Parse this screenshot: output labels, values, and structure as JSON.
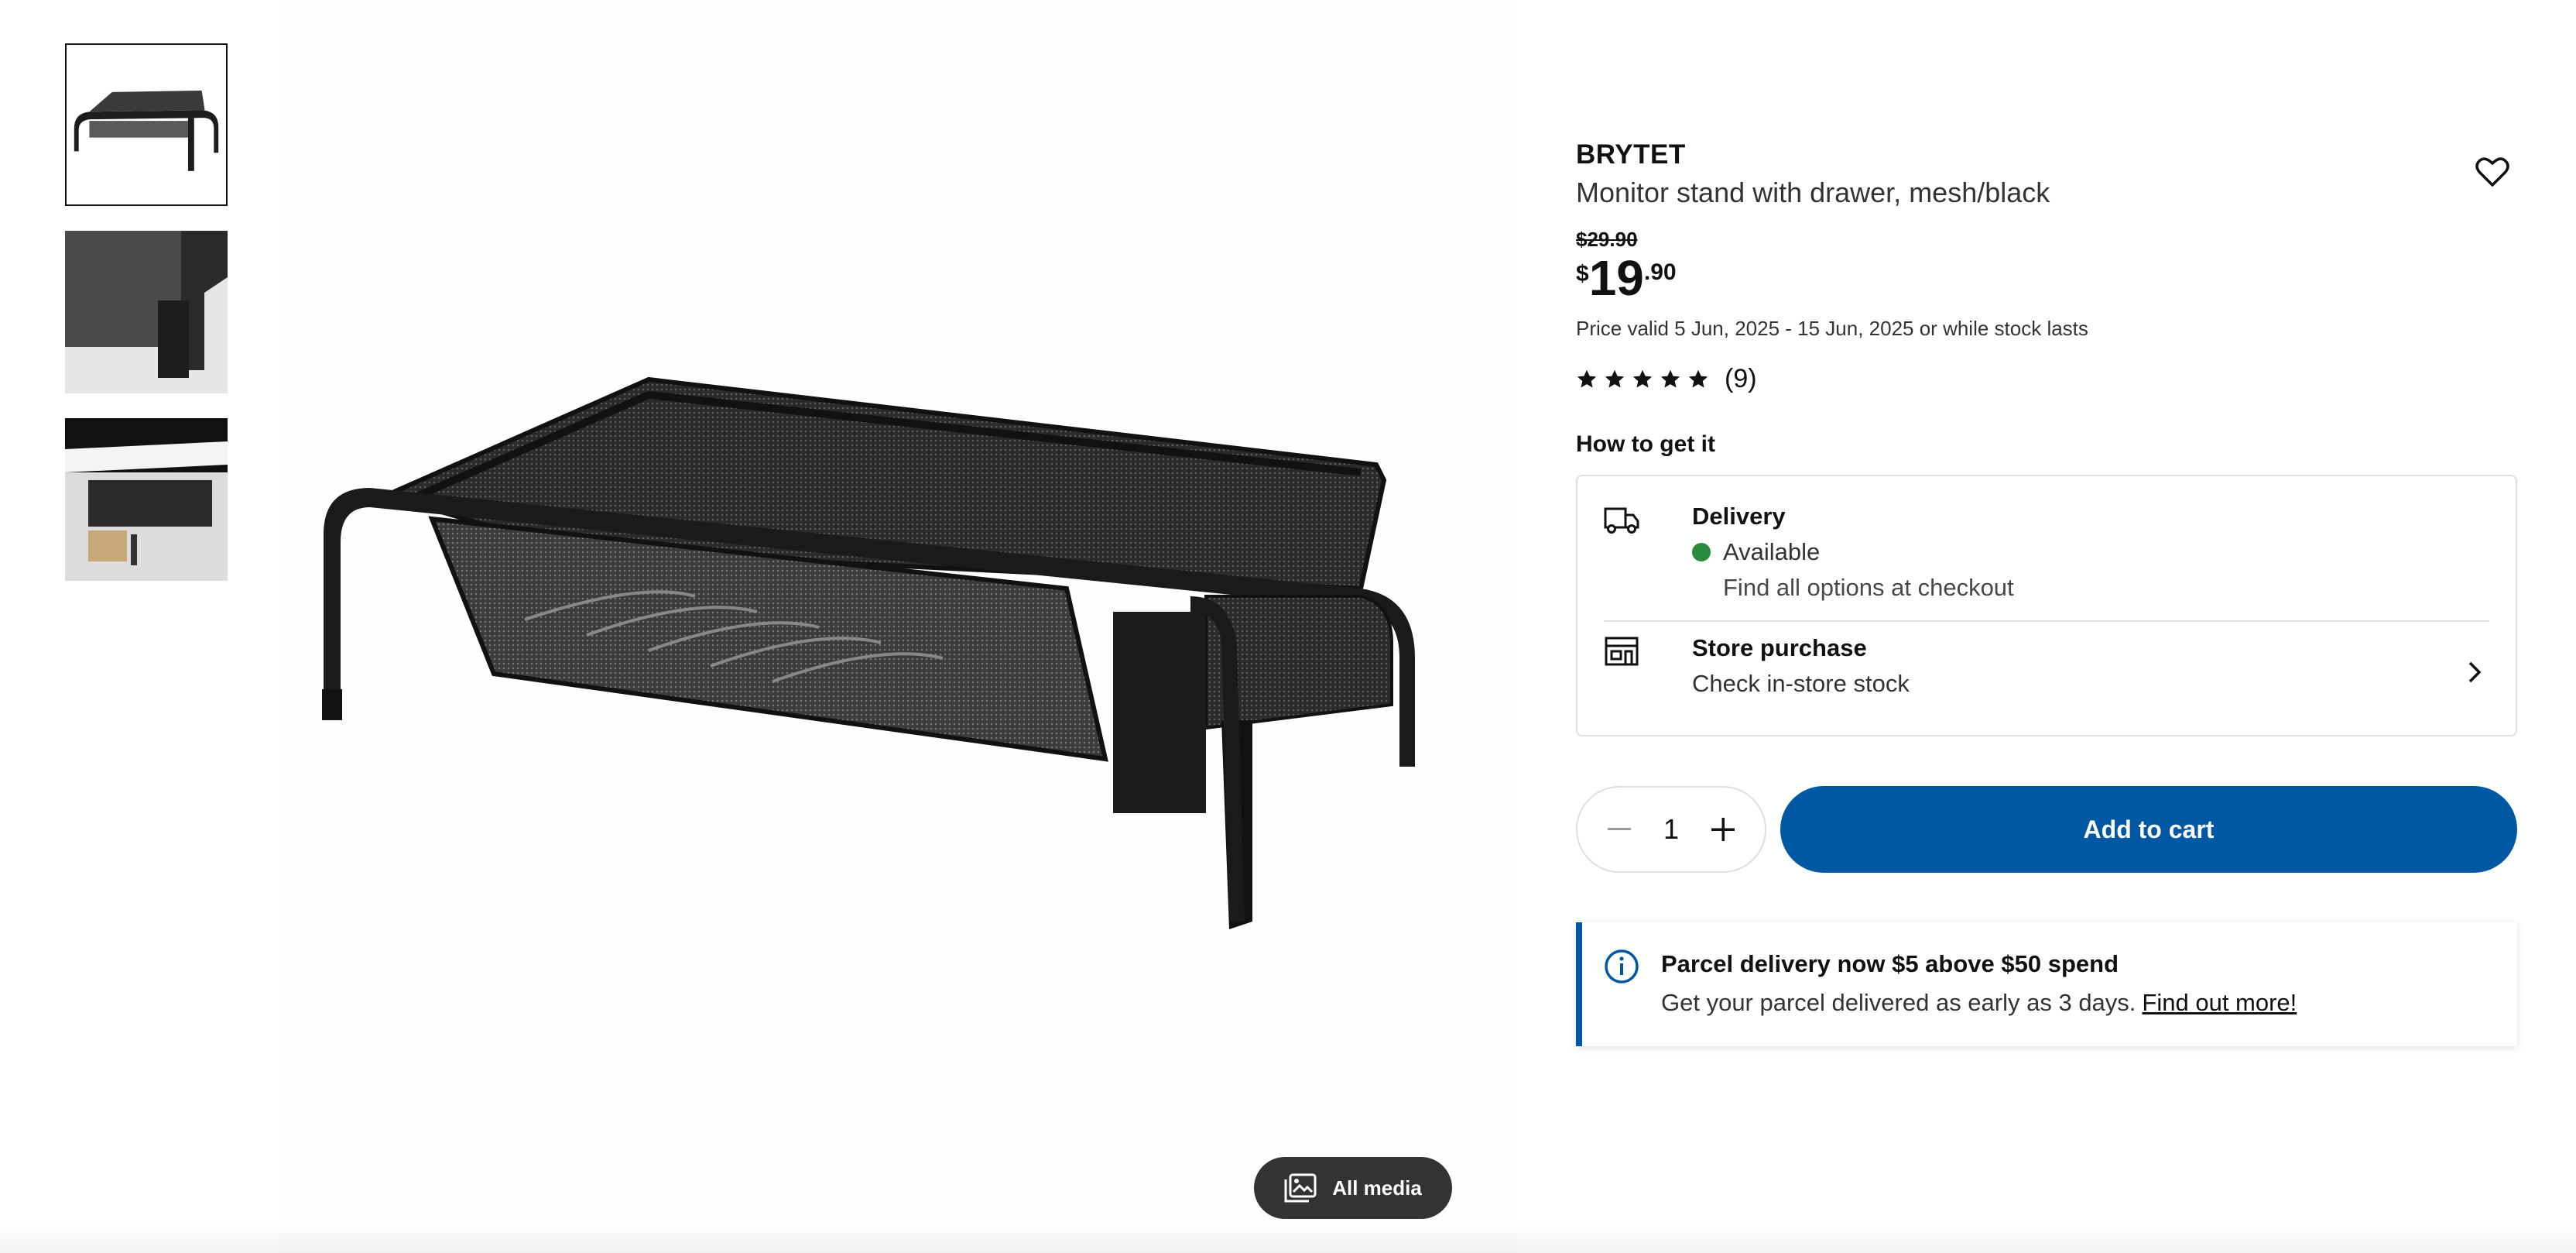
{
  "product": {
    "brand": "BRYTET",
    "description": "Monitor stand with drawer, mesh/black",
    "old_price": "$29.90",
    "price_currency": "$",
    "price_integer": "19",
    "price_decimal": ".90",
    "validity": "Price valid 5 Jun, 2025 - 15 Jun, 2025 or while stock lasts",
    "rating_stars": 5,
    "rating_count": "(9)"
  },
  "media": {
    "thumbnails": [
      "thumbnail-1",
      "thumbnail-2",
      "thumbnail-3"
    ],
    "active_thumbnail": 0,
    "all_media_label": "All media"
  },
  "fulfillment": {
    "title": "How to get it",
    "delivery": {
      "title": "Delivery",
      "status": "Available",
      "note": "Find all options at checkout"
    },
    "store": {
      "title": "Store purchase",
      "note": "Check in-store stock"
    }
  },
  "purchase": {
    "quantity": "1",
    "add_to_cart_label": "Add to cart"
  },
  "notice": {
    "title": "Parcel delivery now $5 above $50 spend",
    "body": "Get your parcel delivered as early as 3 days.",
    "link": "Find out more!"
  },
  "colors": {
    "primary_blue": "#0058a3",
    "available_green": "#2a8a3e",
    "dark_button": "#333333"
  }
}
